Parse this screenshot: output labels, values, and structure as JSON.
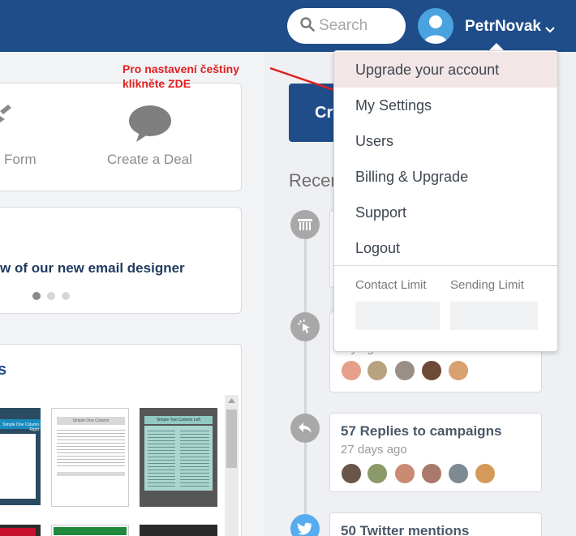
{
  "header": {
    "search_placeholder": "Search",
    "username": "PetrNovak",
    "bar_color": "#1f4d8a"
  },
  "left": {
    "quick_actions": [
      "Form",
      "Create a Deal"
    ],
    "designer_banner": "w of our new email designer",
    "carousel": {
      "total": 3,
      "active": 1
    },
    "templates_title": "s",
    "template_thumbs": [
      "Simple One Column Right",
      "Simple One Column",
      "Simple Two Column Left"
    ]
  },
  "annotation": {
    "line1": "Pro nastavení češtiny",
    "line2": "klikněte ZDE"
  },
  "right": {
    "create_label": "Cre",
    "recent_label": "Recen",
    "timeline": [
      {
        "icon": "campaign-icon"
      },
      {
        "icon": "click-icon",
        "title": "",
        "subtitle": "...y ag"
      },
      {
        "icon": "reply-icon",
        "title": "57 Replies to campaigns",
        "subtitle": "27 days ago"
      },
      {
        "icon": "twitter-icon",
        "title": "50 Twitter mentions"
      }
    ]
  },
  "dropdown": {
    "items": [
      "Upgrade your account",
      "My Settings",
      "Users",
      "Billing & Upgrade",
      "Support",
      "Logout"
    ],
    "contact_limit": "Contact Limit",
    "sending_limit": "Sending Limit"
  }
}
